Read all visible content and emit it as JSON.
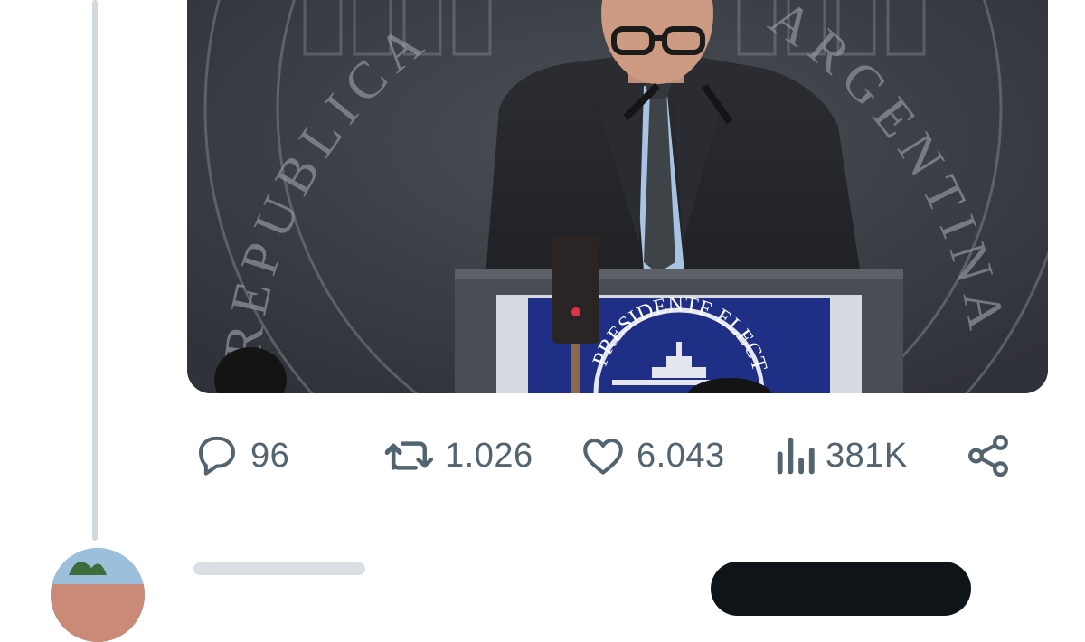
{
  "tweet": {
    "media": {
      "seal_text_left": "REPUBLICA",
      "seal_text_right": "ARGENTINA",
      "podium_sign_text": "PRESIDENTE ELECTO"
    },
    "actions": {
      "replies": {
        "icon": "reply-icon",
        "count": "96"
      },
      "retweets": {
        "icon": "retweet-icon",
        "count": "1.026"
      },
      "likes": {
        "icon": "heart-icon",
        "count": "6.043"
      },
      "views": {
        "icon": "analytics-icon",
        "count": "381K"
      },
      "share": {
        "icon": "share-icon"
      }
    }
  },
  "colors": {
    "icon_gray": "#536471",
    "thread_line": "#cfd9de",
    "button_dark": "#0f1419"
  }
}
